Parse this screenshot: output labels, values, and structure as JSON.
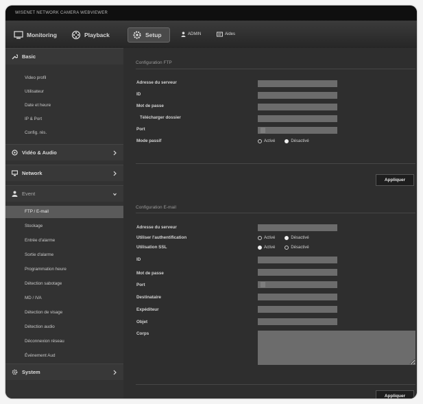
{
  "window": {
    "title": "WISENET NETWORK CAMERA WEBVIEWER"
  },
  "topbar": {
    "monitoring": "Monitoring",
    "playback": "Playback",
    "setup": "Setup",
    "user": "ADMIN",
    "help": "Aides"
  },
  "sidebar": {
    "basic": "Basic",
    "basic_items": [
      "Video profil",
      "Utilisateur",
      "Date et heure",
      "IP & Port",
      "Config. rés."
    ],
    "video_audio": "Vidéo & Audio",
    "network": "Network",
    "event": "Event",
    "event_items": [
      "FTP / E-mail",
      "Stockage",
      "Entrée d'alarme",
      "Sortie d'alarme",
      "Programmation heure",
      "Détection sabotage",
      "MD / IVA",
      "Détection de visage",
      "Détection audio",
      "Déconnexion réseau",
      "Événement Aud"
    ],
    "system": "System"
  },
  "ftp": {
    "title": "Configuration FTP",
    "labels": [
      "Adresse du serveur",
      "ID",
      "Mot de passe",
      "Télécharger dossier",
      "Port",
      "Mode passif"
    ],
    "passive_on": "Activé",
    "passive_off": "Désactivé",
    "passive_selected": "off",
    "apply": "Appliquer"
  },
  "email": {
    "title": "Configuration E-mail",
    "labels": [
      "Adresse du serveur",
      "Utiliser l'authentification",
      "Utilisation SSL",
      "ID",
      "Mot de passe",
      "Port",
      "Destinataire",
      "Expéditeur",
      "Objet",
      "Corps"
    ],
    "auth_on": "Activé",
    "auth_off": "Désactivé",
    "auth_selected": "off",
    "ssl_on": "Activé",
    "ssl_off": "Désactivé",
    "ssl_selected": "on",
    "apply": "Appliquer"
  },
  "colors": {
    "accent": "#5a5a5a",
    "background": "#2e2e2e",
    "field": "#6c6c6c"
  }
}
